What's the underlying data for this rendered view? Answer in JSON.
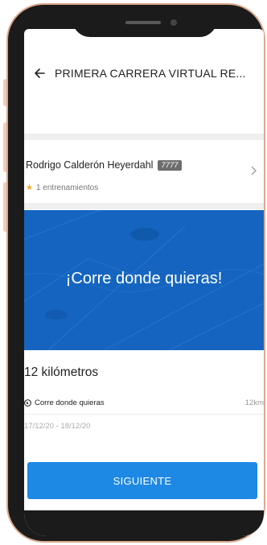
{
  "app_bar": {
    "title": "PRIMERA CARRERA VIRTUAL RE..."
  },
  "athlete": {
    "name": "Rodrigo Calderón Heyerdahl",
    "badge": "7777",
    "trainings": "1 entrenamientos"
  },
  "banner": {
    "text": "¡Corre donde quieras!"
  },
  "event": {
    "title": "12 kilómetros",
    "mode_label": "Corre donde quieras",
    "distance": "12km",
    "dates": "17/12/20 - 18/12/20"
  },
  "actions": {
    "next_label": "SIGUIENTE"
  },
  "colors": {
    "banner": "#1565c0",
    "button": "#1e88e5",
    "star": "#f5a623",
    "frame": "#1b1b1b",
    "frame_edge": "#d9a98c"
  },
  "icons": {
    "back": "arrow-left-icon",
    "star": "star-icon",
    "chevron": "chevron-right-icon",
    "globe": "globe-icon"
  }
}
